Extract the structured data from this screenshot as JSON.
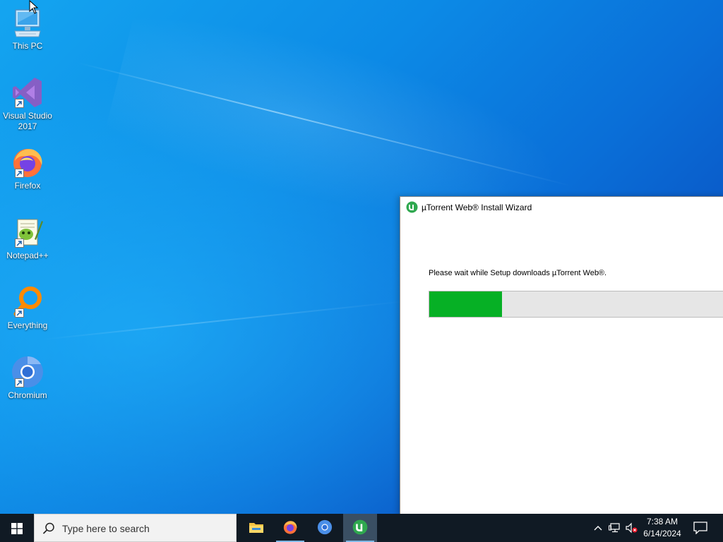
{
  "desktop": {
    "icons": [
      {
        "label": "This PC",
        "icon": "this-pc-icon"
      },
      {
        "label": "Visual Studio 2017",
        "icon": "visual-studio-icon"
      },
      {
        "label": "Firefox",
        "icon": "firefox-icon"
      },
      {
        "label": "Notepad++",
        "icon": "notepad-plus-plus-icon"
      },
      {
        "label": "Everything",
        "icon": "everything-search-icon"
      },
      {
        "label": "Chromium",
        "icon": "chromium-icon"
      }
    ]
  },
  "installer": {
    "title": "µTorrent Web® Install Wizard",
    "message": "Please wait while Setup downloads µTorrent Web®.",
    "progress_fraction": 0.235,
    "colors": {
      "progress_fill": "#06b025",
      "progress_track": "#e6e6e6"
    }
  },
  "taskbar": {
    "search_placeholder": "Type here to search",
    "pinned_apps": [
      {
        "name": "File Explorer",
        "icon": "file-explorer-icon"
      },
      {
        "name": "Firefox",
        "icon": "firefox-icon"
      },
      {
        "name": "Chromium",
        "icon": "chromium-icon"
      },
      {
        "name": "µTorrent Web",
        "icon": "utorrent-icon",
        "active": true
      }
    ],
    "tray": {
      "time": "7:38 AM",
      "date": "6/14/2024"
    }
  }
}
